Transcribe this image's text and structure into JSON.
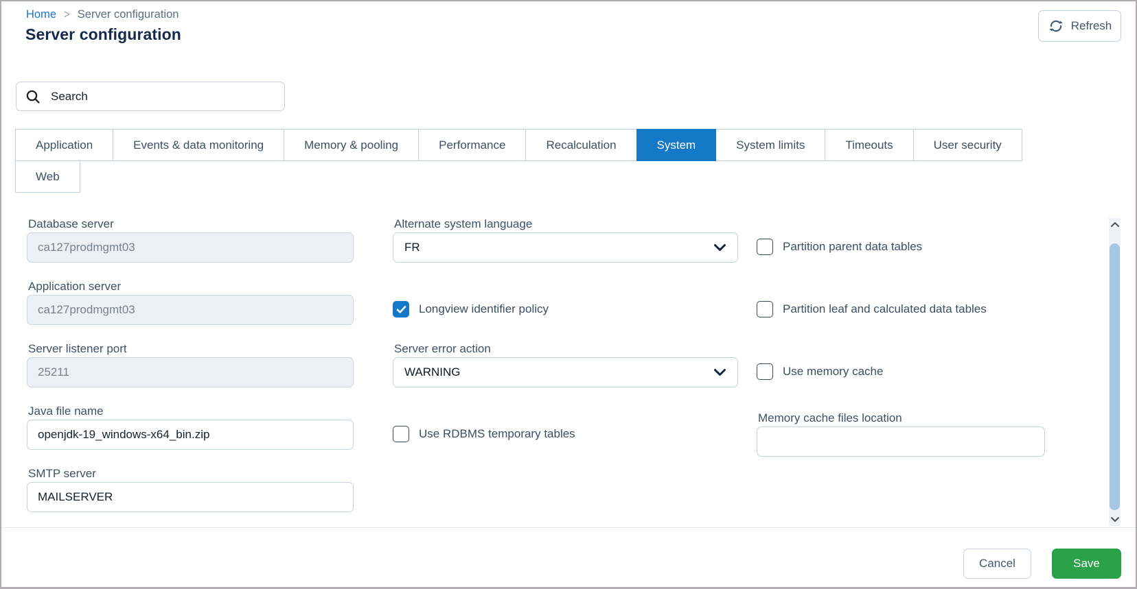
{
  "breadcrumb": {
    "home_label": "Home",
    "separator": ">",
    "current_label": "Server configuration"
  },
  "header": {
    "title": "Server configuration",
    "refresh_button_label": "Refresh"
  },
  "search": {
    "placeholder": "Search"
  },
  "tabs": [
    {
      "label": "Application",
      "active": false
    },
    {
      "label": "Events & data monitoring",
      "active": false
    },
    {
      "label": "Memory & pooling",
      "active": false
    },
    {
      "label": "Performance",
      "active": false
    },
    {
      "label": "Recalculation",
      "active": false
    },
    {
      "label": "System",
      "active": true
    },
    {
      "label": "System limits",
      "active": false
    },
    {
      "label": "Timeouts",
      "active": false
    },
    {
      "label": "User security",
      "active": false
    },
    {
      "label": "Web",
      "active": false
    }
  ],
  "form": {
    "database_server": {
      "label": "Database server",
      "value": "ca127prodmgmt03",
      "disabled": true
    },
    "application_server": {
      "label": "Application server",
      "value": "ca127prodmgmt03",
      "disabled": true
    },
    "server_listener_port": {
      "label": "Server listener port",
      "value": "25211",
      "disabled": true
    },
    "java_file_name": {
      "label": "Java file name",
      "value": "openjdk-19_windows-x64_bin.zip",
      "disabled": false
    },
    "smtp_server": {
      "label": "SMTP server",
      "value": "MAILSERVER",
      "disabled": false
    },
    "alternate_system_language": {
      "label": "Alternate system language",
      "value": "FR"
    },
    "longview_identifier_policy": {
      "label": "Longview identifier policy",
      "checked": true
    },
    "server_error_action": {
      "label": "Server error action",
      "value": "WARNING"
    },
    "use_rdbms_temporary_tables": {
      "label": "Use RDBMS temporary tables",
      "checked": false
    },
    "partition_parent_data_tables": {
      "label": "Partition parent data tables",
      "checked": false
    },
    "partition_leaf_and_calculated_data_tables": {
      "label": "Partition leaf and calculated data tables",
      "checked": false
    },
    "use_memory_cache": {
      "label": "Use memory cache",
      "checked": false
    },
    "memory_cache_files_location": {
      "label": "Memory cache files location",
      "value": ""
    }
  },
  "footer": {
    "cancel_label": "Cancel",
    "save_label": "Save"
  },
  "colors": {
    "accent_blue": "#1378c5",
    "link_blue": "#1d74d0",
    "save_green": "#2ba149",
    "title_navy": "#15294b",
    "label_slate": "#3f5166",
    "scrollbar_thumb": "#a6c6e6"
  }
}
